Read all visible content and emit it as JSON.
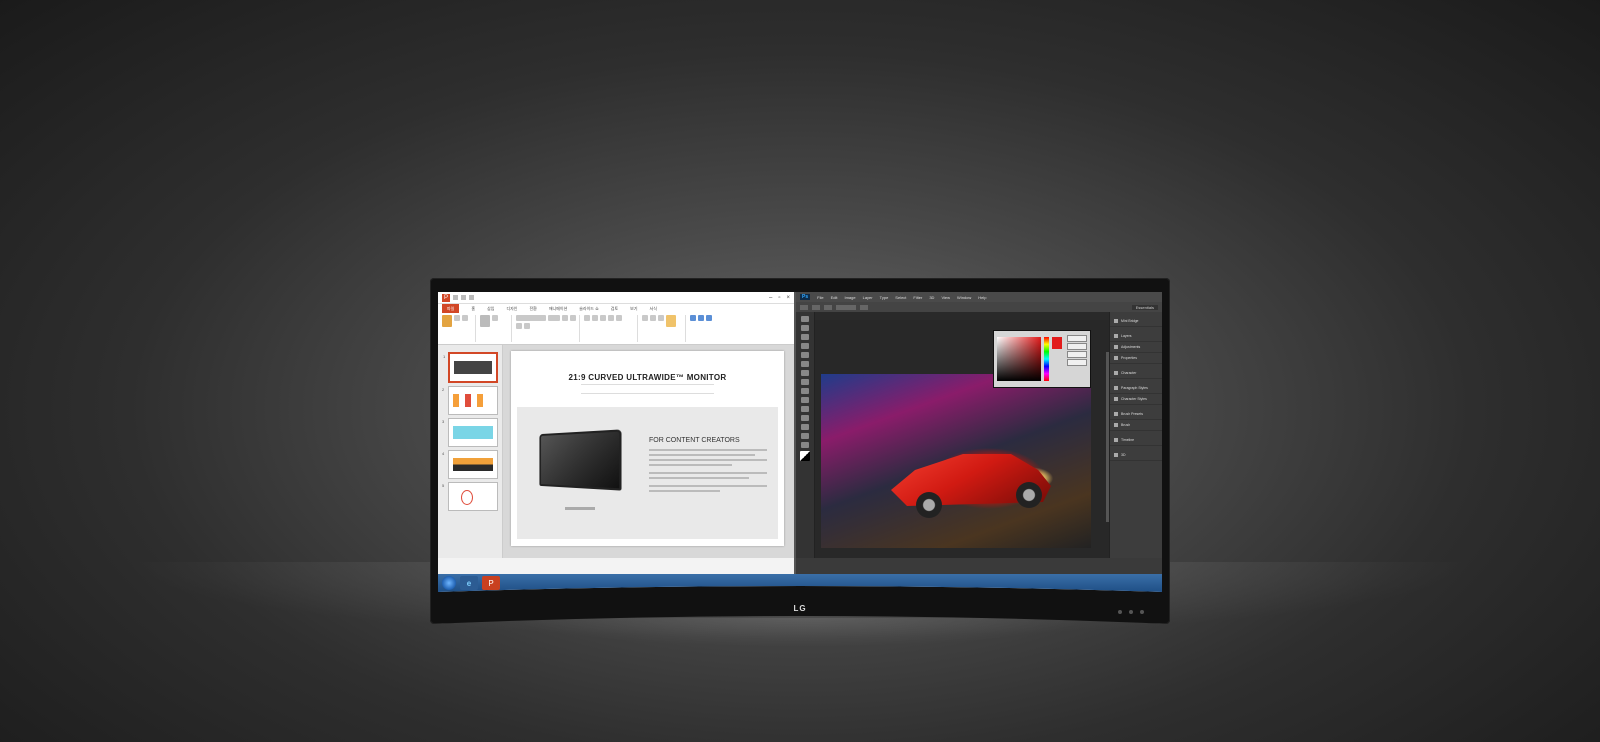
{
  "brand": {
    "logo": "LG"
  },
  "powerpoint": {
    "tabs": [
      "파일",
      "홈",
      "삽입",
      "디자인",
      "전환",
      "애니메이션",
      "슬라이드 쇼",
      "검토",
      "보기",
      "서식"
    ],
    "slides": [
      {
        "num": "1"
      },
      {
        "num": "2"
      },
      {
        "num": "3"
      },
      {
        "num": "4"
      },
      {
        "num": "5"
      }
    ],
    "slide": {
      "title": "21:9 CURVED ULTRAWIDE™ MONITOR",
      "heading": "FOR CONTENT CREATORS"
    }
  },
  "photoshop": {
    "logo": "Ps",
    "menu": [
      "File",
      "Edit",
      "Image",
      "Layer",
      "Type",
      "Select",
      "Filter",
      "3D",
      "View",
      "Window",
      "Help"
    ],
    "essentials": "Essentials",
    "panels": [
      "Mini Bridge",
      "Layers",
      "Adjustments",
      "Properties",
      "Character",
      "Paragraph Styles",
      "Character Styles",
      "Brush Presets",
      "Brush",
      "Timeline",
      "3D"
    ]
  }
}
